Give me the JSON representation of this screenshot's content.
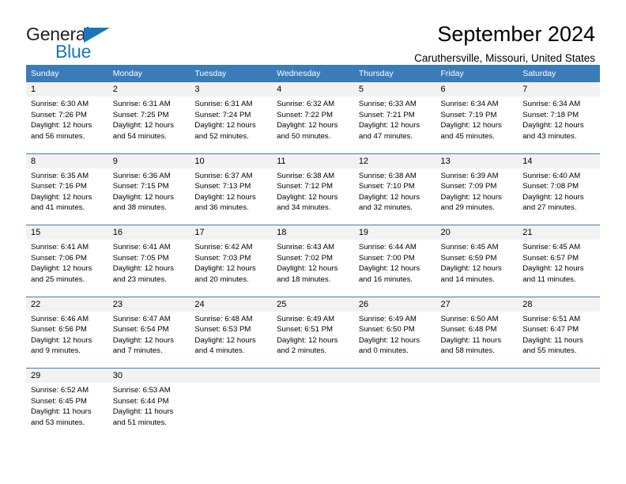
{
  "brand": {
    "name_part1": "General",
    "name_part2": "Blue",
    "triangle_color": "#1b75bb"
  },
  "header": {
    "title": "September 2024",
    "subtitle": "Caruthersville, Missouri, United States"
  },
  "colors": {
    "header_row_bg": "#3a7cb9",
    "daynum_bg": "#f2f2f2",
    "cell_bg": "#ffffff",
    "text": "#000000",
    "brand_blue": "#1b75bb"
  },
  "calendar": {
    "weekday_headers": [
      "Sunday",
      "Monday",
      "Tuesday",
      "Wednesday",
      "Thursday",
      "Friday",
      "Saturday"
    ],
    "weeks": [
      {
        "days": [
          {
            "num": "1",
            "sunrise": "Sunrise: 6:30 AM",
            "sunset": "Sunset: 7:26 PM",
            "daylight1": "Daylight: 12 hours",
            "daylight2": "and 56 minutes."
          },
          {
            "num": "2",
            "sunrise": "Sunrise: 6:31 AM",
            "sunset": "Sunset: 7:25 PM",
            "daylight1": "Daylight: 12 hours",
            "daylight2": "and 54 minutes."
          },
          {
            "num": "3",
            "sunrise": "Sunrise: 6:31 AM",
            "sunset": "Sunset: 7:24 PM",
            "daylight1": "Daylight: 12 hours",
            "daylight2": "and 52 minutes."
          },
          {
            "num": "4",
            "sunrise": "Sunrise: 6:32 AM",
            "sunset": "Sunset: 7:22 PM",
            "daylight1": "Daylight: 12 hours",
            "daylight2": "and 50 minutes."
          },
          {
            "num": "5",
            "sunrise": "Sunrise: 6:33 AM",
            "sunset": "Sunset: 7:21 PM",
            "daylight1": "Daylight: 12 hours",
            "daylight2": "and 47 minutes."
          },
          {
            "num": "6",
            "sunrise": "Sunrise: 6:34 AM",
            "sunset": "Sunset: 7:19 PM",
            "daylight1": "Daylight: 12 hours",
            "daylight2": "and 45 minutes."
          },
          {
            "num": "7",
            "sunrise": "Sunrise: 6:34 AM",
            "sunset": "Sunset: 7:18 PM",
            "daylight1": "Daylight: 12 hours",
            "daylight2": "and 43 minutes."
          }
        ]
      },
      {
        "days": [
          {
            "num": "8",
            "sunrise": "Sunrise: 6:35 AM",
            "sunset": "Sunset: 7:16 PM",
            "daylight1": "Daylight: 12 hours",
            "daylight2": "and 41 minutes."
          },
          {
            "num": "9",
            "sunrise": "Sunrise: 6:36 AM",
            "sunset": "Sunset: 7:15 PM",
            "daylight1": "Daylight: 12 hours",
            "daylight2": "and 38 minutes."
          },
          {
            "num": "10",
            "sunrise": "Sunrise: 6:37 AM",
            "sunset": "Sunset: 7:13 PM",
            "daylight1": "Daylight: 12 hours",
            "daylight2": "and 36 minutes."
          },
          {
            "num": "11",
            "sunrise": "Sunrise: 6:38 AM",
            "sunset": "Sunset: 7:12 PM",
            "daylight1": "Daylight: 12 hours",
            "daylight2": "and 34 minutes."
          },
          {
            "num": "12",
            "sunrise": "Sunrise: 6:38 AM",
            "sunset": "Sunset: 7:10 PM",
            "daylight1": "Daylight: 12 hours",
            "daylight2": "and 32 minutes."
          },
          {
            "num": "13",
            "sunrise": "Sunrise: 6:39 AM",
            "sunset": "Sunset: 7:09 PM",
            "daylight1": "Daylight: 12 hours",
            "daylight2": "and 29 minutes."
          },
          {
            "num": "14",
            "sunrise": "Sunrise: 6:40 AM",
            "sunset": "Sunset: 7:08 PM",
            "daylight1": "Daylight: 12 hours",
            "daylight2": "and 27 minutes."
          }
        ]
      },
      {
        "days": [
          {
            "num": "15",
            "sunrise": "Sunrise: 6:41 AM",
            "sunset": "Sunset: 7:06 PM",
            "daylight1": "Daylight: 12 hours",
            "daylight2": "and 25 minutes."
          },
          {
            "num": "16",
            "sunrise": "Sunrise: 6:41 AM",
            "sunset": "Sunset: 7:05 PM",
            "daylight1": "Daylight: 12 hours",
            "daylight2": "and 23 minutes."
          },
          {
            "num": "17",
            "sunrise": "Sunrise: 6:42 AM",
            "sunset": "Sunset: 7:03 PM",
            "daylight1": "Daylight: 12 hours",
            "daylight2": "and 20 minutes."
          },
          {
            "num": "18",
            "sunrise": "Sunrise: 6:43 AM",
            "sunset": "Sunset: 7:02 PM",
            "daylight1": "Daylight: 12 hours",
            "daylight2": "and 18 minutes."
          },
          {
            "num": "19",
            "sunrise": "Sunrise: 6:44 AM",
            "sunset": "Sunset: 7:00 PM",
            "daylight1": "Daylight: 12 hours",
            "daylight2": "and 16 minutes."
          },
          {
            "num": "20",
            "sunrise": "Sunrise: 6:45 AM",
            "sunset": "Sunset: 6:59 PM",
            "daylight1": "Daylight: 12 hours",
            "daylight2": "and 14 minutes."
          },
          {
            "num": "21",
            "sunrise": "Sunrise: 6:45 AM",
            "sunset": "Sunset: 6:57 PM",
            "daylight1": "Daylight: 12 hours",
            "daylight2": "and 11 minutes."
          }
        ]
      },
      {
        "days": [
          {
            "num": "22",
            "sunrise": "Sunrise: 6:46 AM",
            "sunset": "Sunset: 6:56 PM",
            "daylight1": "Daylight: 12 hours",
            "daylight2": "and 9 minutes."
          },
          {
            "num": "23",
            "sunrise": "Sunrise: 6:47 AM",
            "sunset": "Sunset: 6:54 PM",
            "daylight1": "Daylight: 12 hours",
            "daylight2": "and 7 minutes."
          },
          {
            "num": "24",
            "sunrise": "Sunrise: 6:48 AM",
            "sunset": "Sunset: 6:53 PM",
            "daylight1": "Daylight: 12 hours",
            "daylight2": "and 4 minutes."
          },
          {
            "num": "25",
            "sunrise": "Sunrise: 6:49 AM",
            "sunset": "Sunset: 6:51 PM",
            "daylight1": "Daylight: 12 hours",
            "daylight2": "and 2 minutes."
          },
          {
            "num": "26",
            "sunrise": "Sunrise: 6:49 AM",
            "sunset": "Sunset: 6:50 PM",
            "daylight1": "Daylight: 12 hours",
            "daylight2": "and 0 minutes."
          },
          {
            "num": "27",
            "sunrise": "Sunrise: 6:50 AM",
            "sunset": "Sunset: 6:48 PM",
            "daylight1": "Daylight: 11 hours",
            "daylight2": "and 58 minutes."
          },
          {
            "num": "28",
            "sunrise": "Sunrise: 6:51 AM",
            "sunset": "Sunset: 6:47 PM",
            "daylight1": "Daylight: 11 hours",
            "daylight2": "and 55 minutes."
          }
        ]
      },
      {
        "days": [
          {
            "num": "29",
            "sunrise": "Sunrise: 6:52 AM",
            "sunset": "Sunset: 6:45 PM",
            "daylight1": "Daylight: 11 hours",
            "daylight2": "and 53 minutes."
          },
          {
            "num": "30",
            "sunrise": "Sunrise: 6:53 AM",
            "sunset": "Sunset: 6:44 PM",
            "daylight1": "Daylight: 11 hours",
            "daylight2": "and 51 minutes."
          },
          {
            "num": "",
            "sunrise": "",
            "sunset": "",
            "daylight1": "",
            "daylight2": ""
          },
          {
            "num": "",
            "sunrise": "",
            "sunset": "",
            "daylight1": "",
            "daylight2": ""
          },
          {
            "num": "",
            "sunrise": "",
            "sunset": "",
            "daylight1": "",
            "daylight2": ""
          },
          {
            "num": "",
            "sunrise": "",
            "sunset": "",
            "daylight1": "",
            "daylight2": ""
          },
          {
            "num": "",
            "sunrise": "",
            "sunset": "",
            "daylight1": "",
            "daylight2": ""
          }
        ]
      }
    ]
  }
}
